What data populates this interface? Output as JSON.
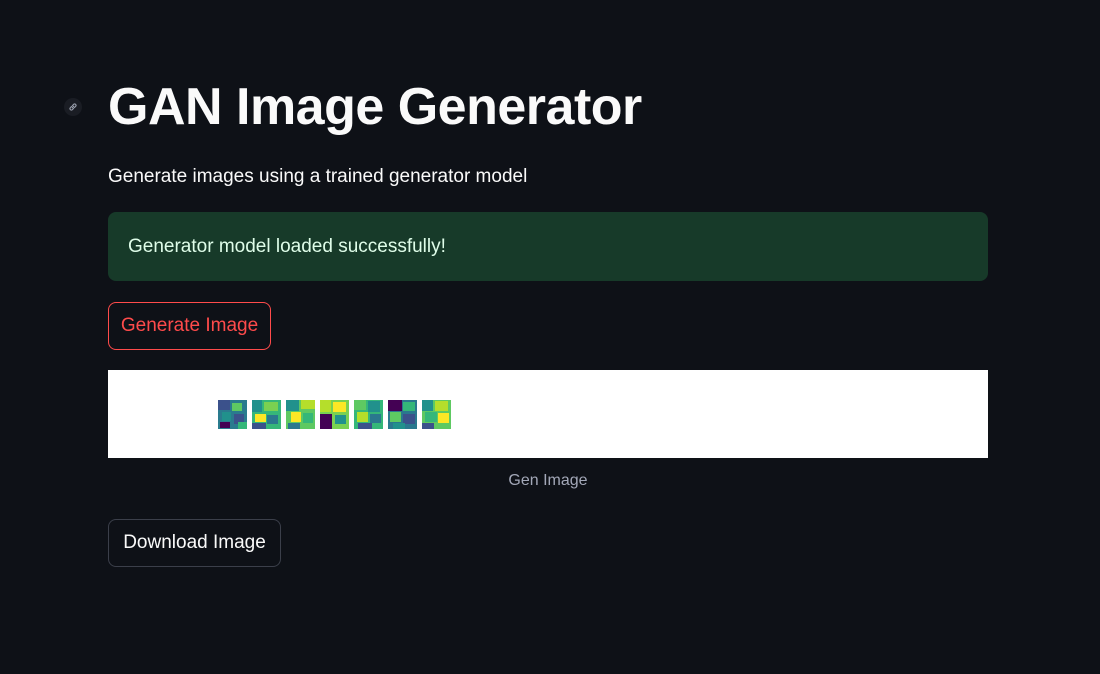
{
  "app": {
    "title": "GAN Image Generator",
    "subtitle": "Generate images using a trained generator model"
  },
  "status": {
    "message": "Generator model loaded successfully!",
    "color": "#173a29"
  },
  "actions": {
    "generate_label": "Generate Image",
    "download_label": "Download Image"
  },
  "output": {
    "caption": "Gen Image",
    "sample_count": 7
  },
  "colors": {
    "background": "#0e1117",
    "accent": "#ff4b4b",
    "text": "#fafafa"
  },
  "icons": {
    "anchor": "link-icon"
  }
}
